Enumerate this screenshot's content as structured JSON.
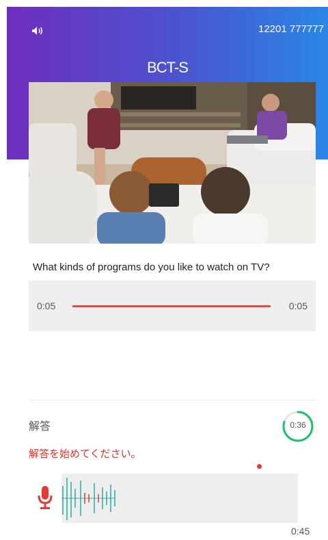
{
  "header": {
    "sound_icon": "speaker-icon",
    "user_id": "12201 777777",
    "app_title": "BCT-S",
    "gradient_colors": [
      "#6f2dbd",
      "#2a86e6"
    ]
  },
  "question": {
    "image": "family-watching-tv-photo",
    "text": "What kinds of programs do you like to watch on TV?"
  },
  "player": {
    "current_time": "0:05",
    "total_time": "0:05",
    "progress": 1.0,
    "accent_color": "#e34a4a"
  },
  "answer": {
    "label": "解答",
    "timer_text": "0:36",
    "timer_progress": 0.8,
    "timer_color": "#1fc06b",
    "instruction": "解答を始めてください。",
    "instruction_color": "#e0302a",
    "mic_icon": "microphone-icon",
    "recording_time": "0:45"
  }
}
